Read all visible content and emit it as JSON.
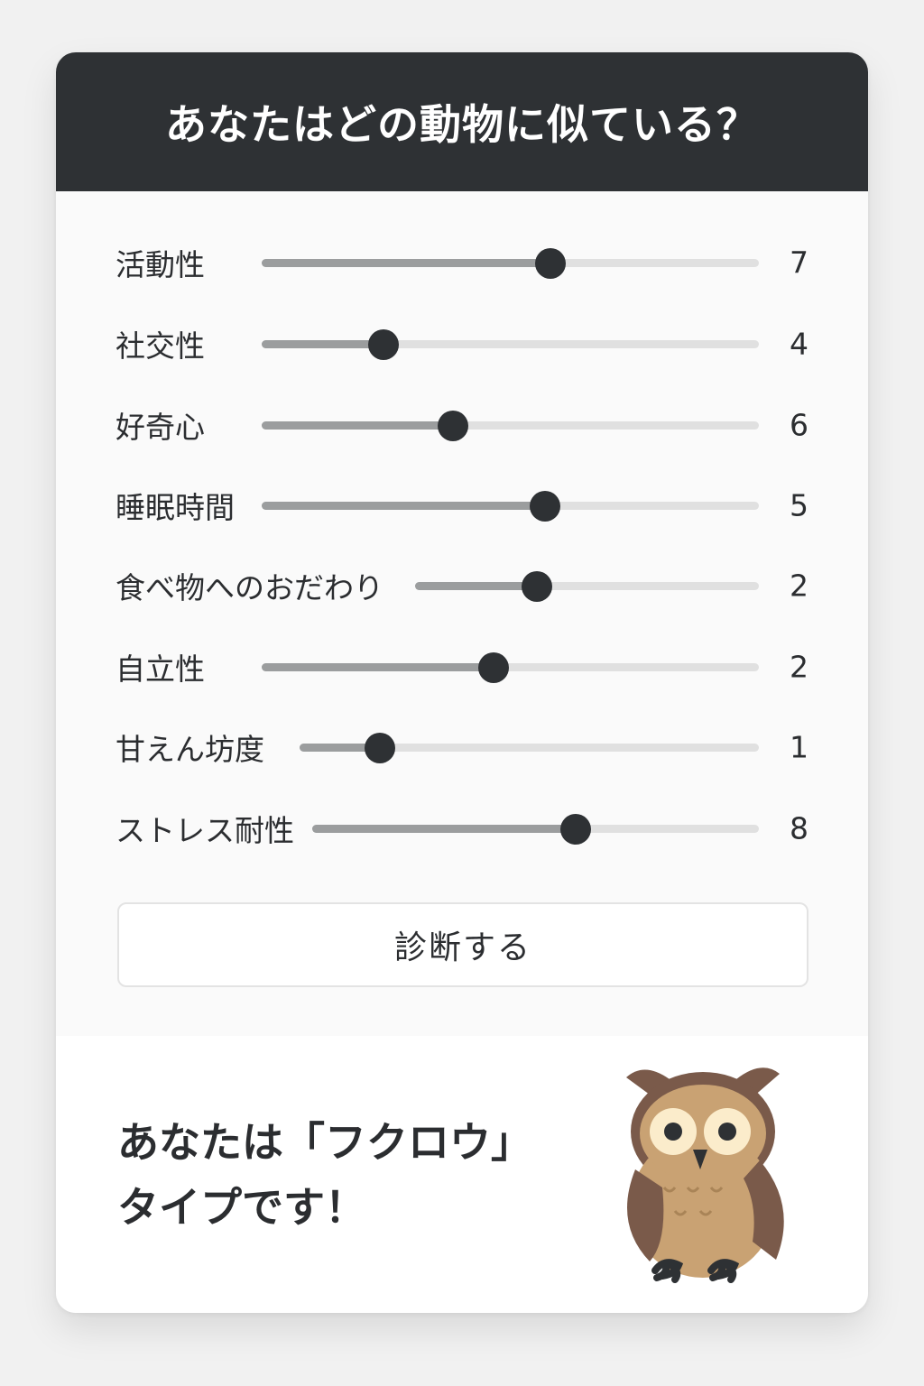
{
  "header": {
    "title": "あなたはどの動物に似ている？"
  },
  "sliders": [
    {
      "label": "活動性",
      "value": "7",
      "position": 0.58
    },
    {
      "label": "社交性",
      "value": "4",
      "position": 0.245
    },
    {
      "label": "好奇心",
      "value": "6",
      "position": 0.385
    },
    {
      "label": "睡眠時間",
      "value": "5",
      "position": 0.57
    },
    {
      "label": "食べ物へのおだわり",
      "value": "2",
      "position": 0.355
    },
    {
      "label": "自立性",
      "value": "2",
      "position": 0.467
    },
    {
      "label": "甘えん坊度",
      "value": "1",
      "position": 0.175
    },
    {
      "label": "ストレス耐性",
      "value": "8",
      "position": 0.59
    }
  ],
  "button": {
    "label": "診断する"
  },
  "result": {
    "line1": "あなたは「フクロウ」",
    "line2": "タイプです！",
    "illustration": "owl-icon"
  },
  "colors": {
    "header_bg": "#2e3134",
    "thumb": "#2e3134",
    "track_fill": "#9b9d9e",
    "track_bg": "#e0e0e0",
    "owl_body": "#c9a273",
    "owl_wing": "#7a5a4a"
  }
}
